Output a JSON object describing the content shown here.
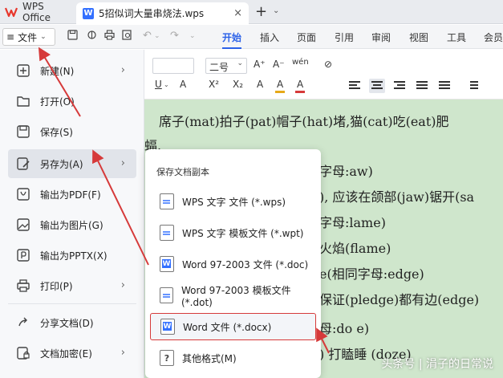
{
  "app": {
    "name": "WPS Office"
  },
  "tab": {
    "doc_icon": "W",
    "title": "5招似词大量串烧法.wps",
    "close": "×",
    "new": "+",
    "new_caret": "⌄"
  },
  "ribbon": {
    "file_label": "文件",
    "menu_glyph": "≡",
    "tabs": [
      "开始",
      "插入",
      "页面",
      "引用",
      "审阅",
      "视图",
      "工具",
      "会员"
    ],
    "active_tab": "开始"
  },
  "toolbar": {
    "font_size": "二号",
    "font_size_caret": "⌄",
    "row1": [
      "A⁺",
      "A⁻",
      "wén",
      "A",
      "⊘"
    ],
    "row2": [
      "U",
      "A",
      "X²",
      "X₂",
      "A",
      "A",
      "A"
    ],
    "colors": {
      "font": "#2c62e8",
      "highlight": "#e6a919",
      "color_red": "#d63a3a"
    }
  },
  "document": {
    "lines": [
      "席子(mat)拍子(pat)帽子(hat)堵,猫(cat)吃(eat)肥",
      "蝠.",
      "字母:aw)",
      "), 应该在颌部(jaw)锯开(sa",
      "字母:lame)",
      "火焰(flame)",
      "e(相同字母:edge)",
      "保证(pledge)都有边(edge)",
      "母:do e)",
      ") 打瞌睡 (doze)"
    ]
  },
  "file_menu": {
    "items": [
      {
        "label": "新建(N)",
        "icon": "new-doc-icon",
        "chevron": true
      },
      {
        "label": "打开(O)",
        "icon": "folder-icon",
        "chevron": false
      },
      {
        "label": "保存(S)",
        "icon": "save-icon",
        "chevron": false
      },
      {
        "label": "另存为(A)",
        "icon": "save-as-icon",
        "chevron": true
      },
      {
        "label": "输出为PDF(F)",
        "icon": "pdf-icon",
        "chevron": false
      },
      {
        "label": "输出为图片(G)",
        "icon": "image-icon",
        "chevron": false
      },
      {
        "label": "输出为PPTX(X)",
        "icon": "pptx-icon",
        "chevron": false
      },
      {
        "label": "打印(P)",
        "icon": "print-icon",
        "chevron": true
      },
      {
        "label": "分享文档(D)",
        "icon": "share-icon",
        "chevron": false
      },
      {
        "label": "文档加密(E)",
        "icon": "lock-icon",
        "chevron": true
      }
    ],
    "chevron_glyph": "›"
  },
  "submenu": {
    "title": "保存文档副本",
    "items": [
      {
        "label": "WPS 文字 文件 (*.wps)",
        "icon": "wps-file-icon"
      },
      {
        "label": "WPS 文字 模板文件 (*.wpt)",
        "icon": "wps-template-icon"
      },
      {
        "label": "Word 97-2003 文件 (*.doc)",
        "icon": "word-doc-icon"
      },
      {
        "label": "Word 97-2003 模板文件 (*.dot)",
        "icon": "word-template-icon"
      },
      {
        "label": "Word 文件 (*.docx)",
        "icon": "word-docx-icon"
      },
      {
        "label": "其他格式(M)",
        "icon": "help-icon"
      }
    ]
  },
  "watermark": "头条号 | 涓子的日常说"
}
